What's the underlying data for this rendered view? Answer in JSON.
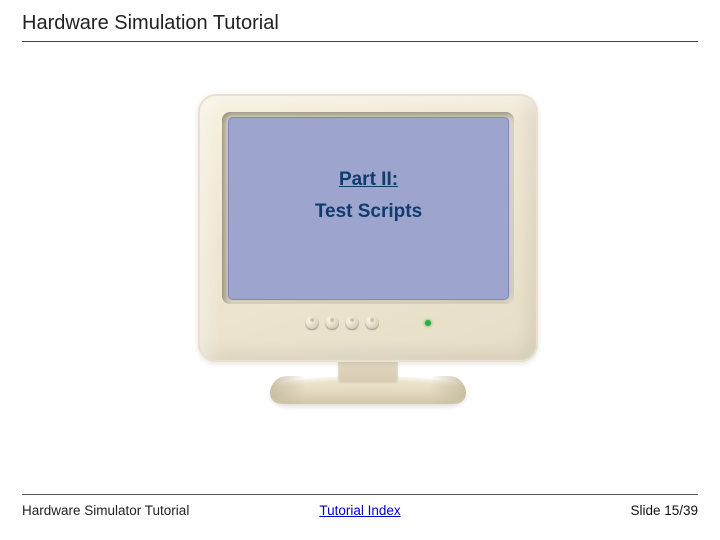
{
  "header": {
    "title": "Hardware Simulation Tutorial"
  },
  "screen": {
    "part": "Part II:",
    "subtitle": "Test Scripts"
  },
  "footer": {
    "left": "Hardware Simulator Tutorial",
    "link": "Tutorial Index",
    "right": "Slide 15/39"
  }
}
